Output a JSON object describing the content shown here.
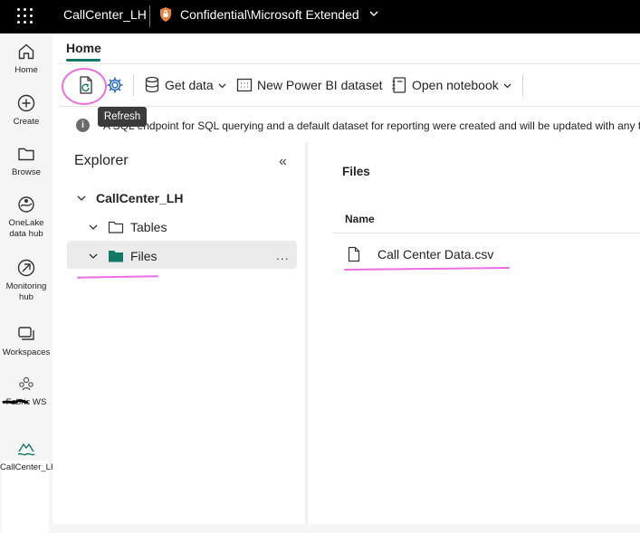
{
  "topbar": {
    "app_title": "CallCenter_LH",
    "sensitivity_label": "Confidential\\Microsoft Extended",
    "icons": [
      "waffle-icon",
      "shield-icon",
      "chevron-down-icon"
    ]
  },
  "rail": {
    "items": [
      {
        "label": "Home",
        "icon": "home-icon"
      },
      {
        "label": "Create",
        "icon": "plus-circle-icon"
      },
      {
        "label": "Browse",
        "icon": "folder-icon"
      },
      {
        "label": "OneLake data hub",
        "icon": "onelake-icon"
      },
      {
        "label": "Monitoring hub",
        "icon": "monitoring-icon"
      },
      {
        "label": "Workspaces",
        "icon": "workspaces-icon"
      },
      {
        "label": "Fabric WS",
        "icon": "workspace-group-icon"
      },
      {
        "label": "CallCenter_LH",
        "icon": "lakehouse-icon"
      }
    ]
  },
  "tabs": {
    "home": "Home"
  },
  "toolbar": {
    "refresh_tooltip": "Refresh",
    "get_data": "Get data",
    "new_dataset": "New Power BI dataset",
    "open_notebook": "Open notebook"
  },
  "info": {
    "text": "A SQL endpoint for SQL querying and a default dataset for reporting were created and will be updated with any t"
  },
  "explorer": {
    "title": "Explorer",
    "collapse_glyph": "«",
    "root": "CallCenter_LH",
    "items": [
      {
        "label": "Tables"
      },
      {
        "label": "Files"
      }
    ],
    "more_glyph": "..."
  },
  "content": {
    "header": "Files",
    "column_name": "Name",
    "files": [
      {
        "name": "Call Center Data.csv"
      }
    ]
  },
  "colors": {
    "accent": "#117865",
    "annotation": "#ea6fe4",
    "topbar": "#000000"
  }
}
